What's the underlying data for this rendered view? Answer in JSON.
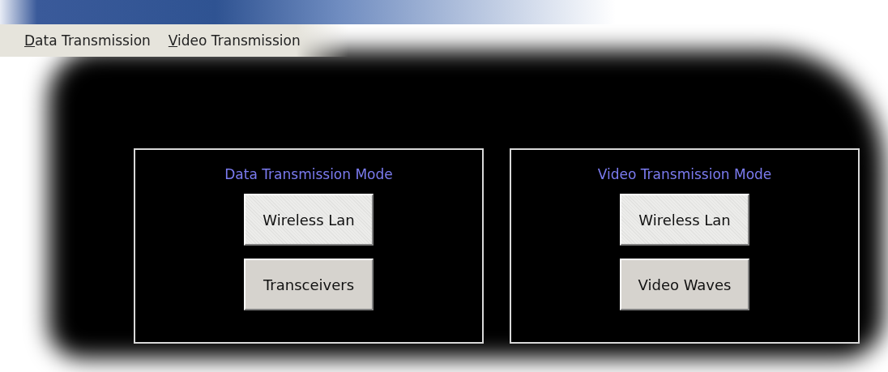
{
  "menu_bar": [
    {
      "label": "Data Transmission"
    },
    {
      "label": "Video Transmission"
    }
  ],
  "panels": [
    {
      "title": "Data Transmission Mode",
      "buttons": [
        {
          "label": "Wireless Lan",
          "focused": true
        },
        {
          "label": "Transceivers",
          "focused": false
        }
      ]
    },
    {
      "title": "Video Transmission Mode",
      "buttons": [
        {
          "label": "Wireless Lan",
          "focused": true
        },
        {
          "label": "Video Waves",
          "focused": false
        }
      ]
    }
  ]
}
